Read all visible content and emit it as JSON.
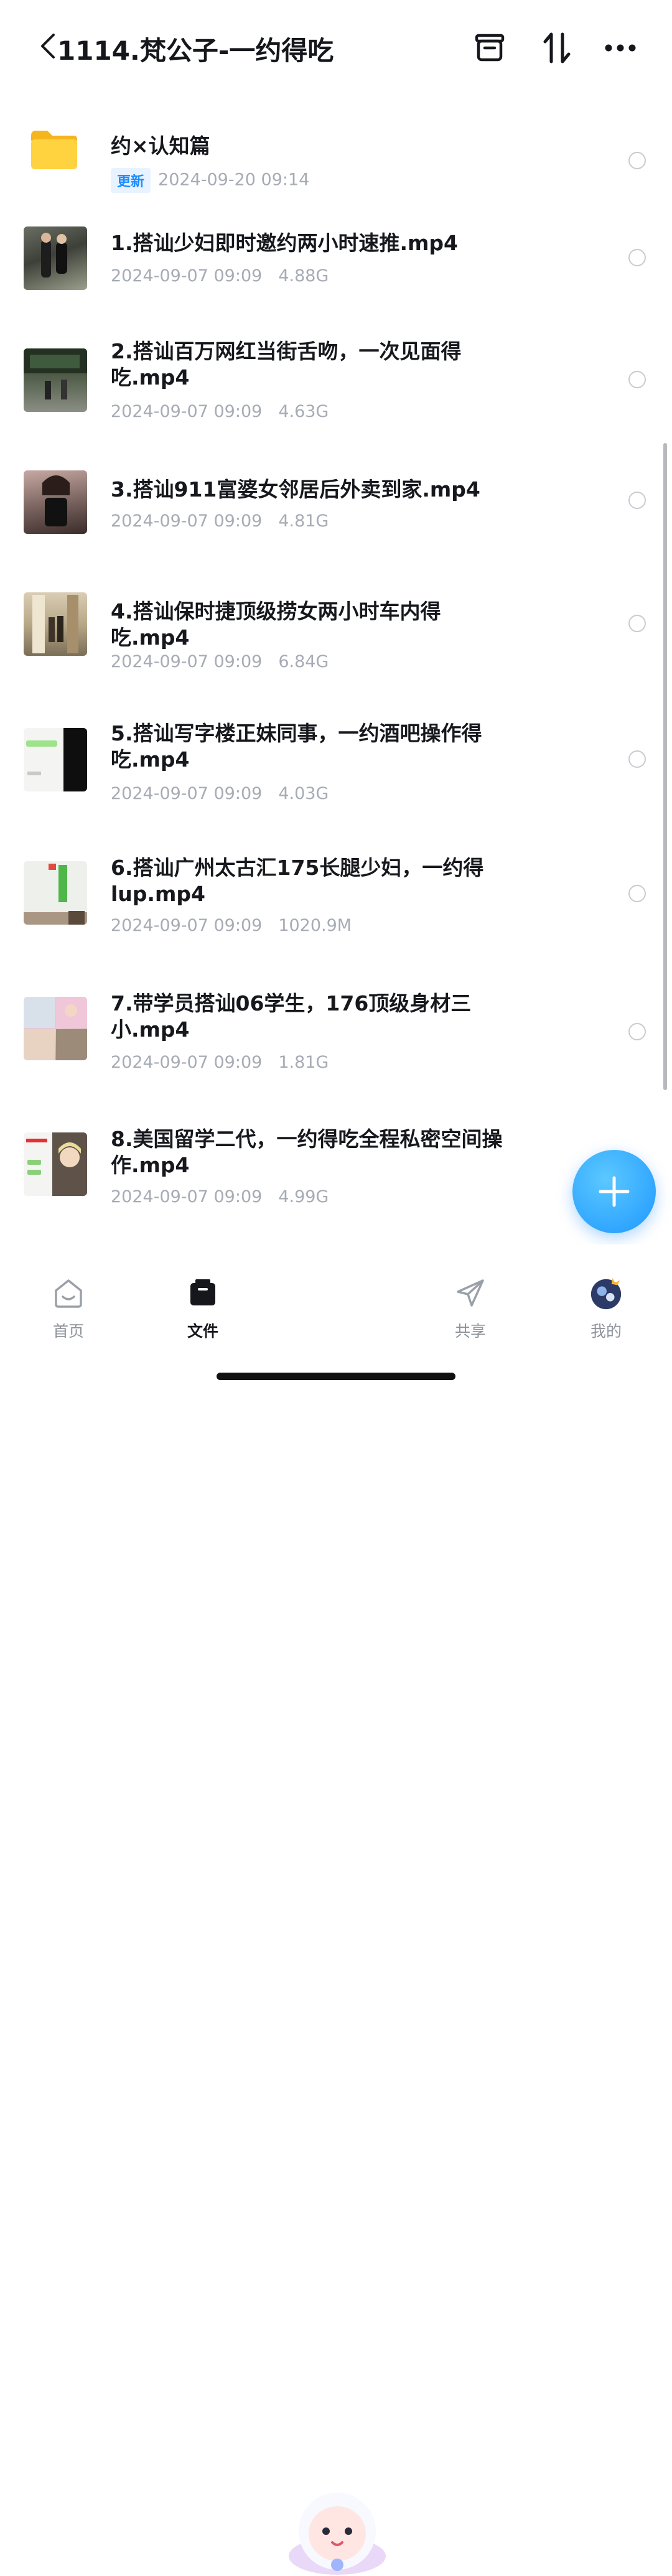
{
  "header": {
    "title": "1114.梵公子-一约得吃",
    "back_icon": "chevron-left-icon",
    "actions": [
      "archive-box-icon",
      "sort-arrows-icon",
      "more-dots-icon"
    ]
  },
  "folder": {
    "name": "约×认知篇",
    "badge": "更新",
    "date": "2024-09-20 09:14",
    "icon": "folder-icon",
    "color": "#FFD23F"
  },
  "files": [
    {
      "name": "1.搭讪少妇即时邀约两小时速推.mp4",
      "date": "2024-09-07 09:09",
      "size": "4.88G"
    },
    {
      "name": "2.搭讪百万网红当街舌吻，一次见面得吃.mp4",
      "date": "2024-09-07 09:09",
      "size": "4.63G"
    },
    {
      "name": "3.搭讪911富婆女邻居后外卖到家.mp4",
      "date": "2024-09-07 09:09",
      "size": "4.81G"
    },
    {
      "name": "4.搭讪保时捷顶级捞女两小时车内得吃.mp4",
      "date": "2024-09-07 09:09",
      "size": "6.84G"
    },
    {
      "name": "5.搭讪写字楼正妹同事，一约酒吧操作得吃.mp4",
      "date": "2024-09-07 09:09",
      "size": "4.03G"
    },
    {
      "name": "6.搭讪广州太古汇175长腿少妇，一约得lup.mp4",
      "date": "2024-09-07 09:09",
      "size": "1020.9M"
    },
    {
      "name": "7.带学员搭讪06学生，176顶级身材三小.mp4",
      "date": "2024-09-07 09:09",
      "size": "1.81G"
    },
    {
      "name": "8.美国留学二代，一约得吃全程私密空间操作.mp4",
      "date": "2024-09-07 09:09",
      "size": "4.99G"
    }
  ],
  "fab": {
    "icon": "plus-icon",
    "color": "#1E98FF"
  },
  "tabbar": {
    "home": {
      "label": "首页",
      "icon": "home-face-icon"
    },
    "files": {
      "label": "文件",
      "icon": "files-icon"
    },
    "center": {
      "icon": "mascot-icon"
    },
    "share": {
      "label": "共享",
      "icon": "paper-plane-icon"
    },
    "me": {
      "label": "我的",
      "icon": "avatar-icon"
    }
  }
}
